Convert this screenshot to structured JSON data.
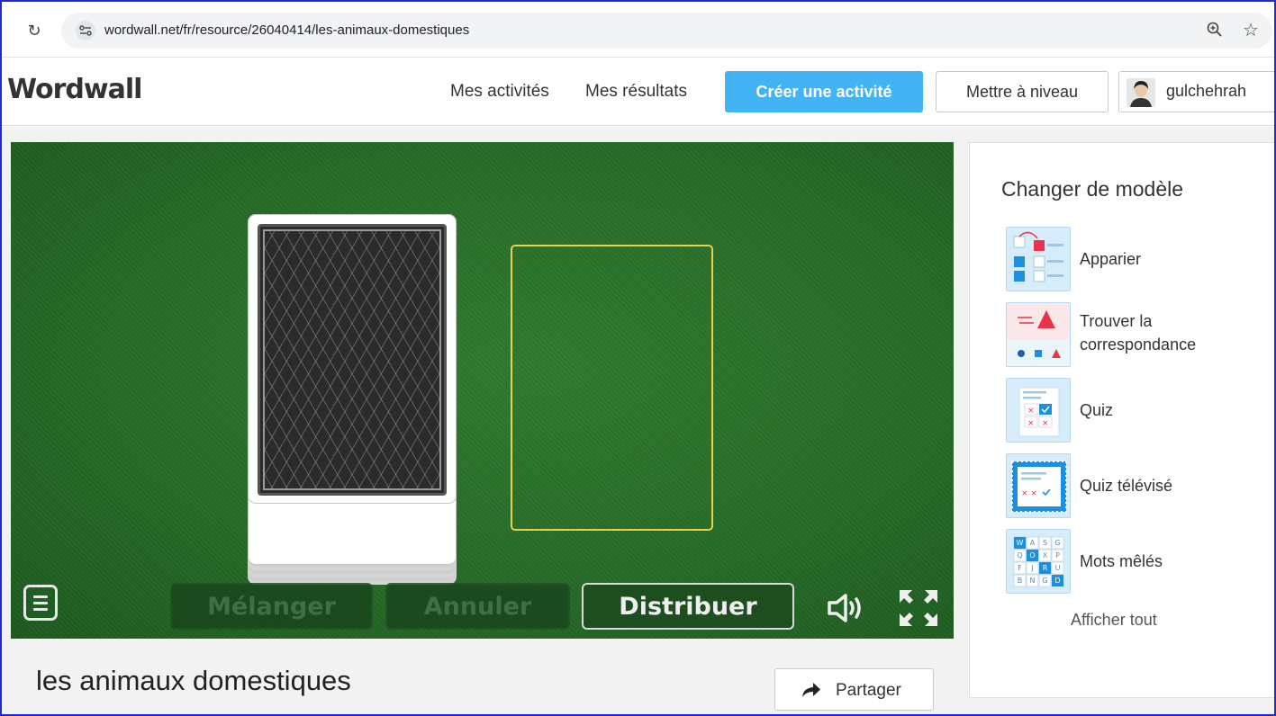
{
  "browser": {
    "url": "wordwall.net/fr/resource/26040414/les-animaux-domestiques",
    "reload_icon": "reload-icon",
    "zoom_icon": "zoom-icon",
    "bookmark_icon": "star-icon"
  },
  "header": {
    "logo": "Wordwall",
    "nav": {
      "my_activities": "Mes activités",
      "my_results": "Mes résultats"
    },
    "create_button": "Créer une activité",
    "upgrade_button": "Mettre à niveau",
    "username": "gulchehrah"
  },
  "game": {
    "buttons": {
      "shuffle": "Mélanger",
      "undo": "Annuler",
      "deal": "Distribuer"
    }
  },
  "activity": {
    "title": "les animaux domestiques",
    "share_button": "Partager"
  },
  "sidebar": {
    "title": "Changer de modèle",
    "templates": [
      {
        "label": "Apparier",
        "icon": "match-up-icon"
      },
      {
        "label": "Trouver la correspondance",
        "icon": "find-match-icon"
      },
      {
        "label": "Quiz",
        "icon": "quiz-icon"
      },
      {
        "label": "Quiz télévisé",
        "icon": "gameshow-quiz-icon"
      },
      {
        "label": "Mots mêlés",
        "icon": "wordsearch-icon"
      }
    ],
    "show_all": "Afficher tout"
  },
  "colors": {
    "accent": "#42b4f5",
    "felt": "#266b27",
    "slot_outline": "#e7d24a"
  }
}
